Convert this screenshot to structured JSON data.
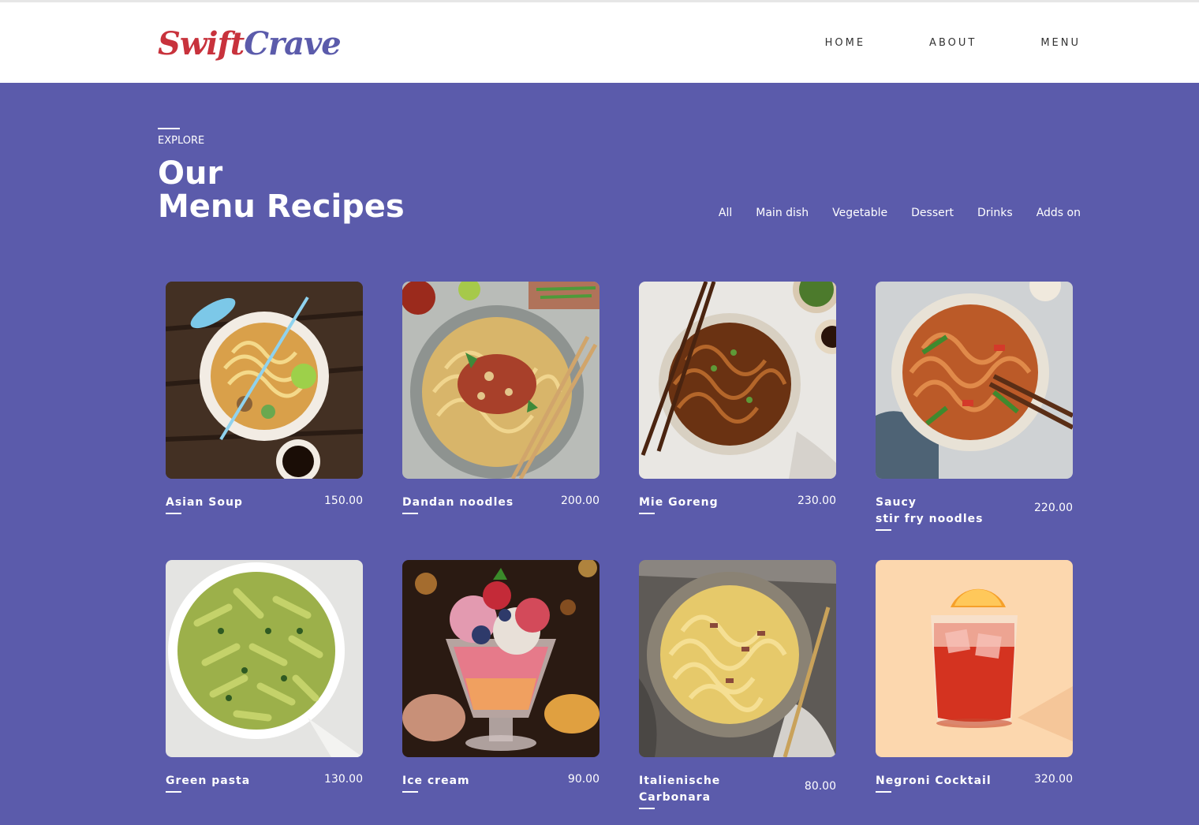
{
  "brand": {
    "part1": "Swift",
    "part2": "Crave"
  },
  "nav": [
    {
      "label": "HOME"
    },
    {
      "label": "ABOUT"
    },
    {
      "label": "MENU"
    }
  ],
  "section": {
    "eyebrow": "EXPLORE",
    "title_line1": "Our",
    "title_line2": "Menu Recipes"
  },
  "filters": [
    {
      "label": "All"
    },
    {
      "label": "Main dish"
    },
    {
      "label": "Vegetable"
    },
    {
      "label": "Dessert"
    },
    {
      "label": "Drinks"
    },
    {
      "label": "Adds on"
    }
  ],
  "menu_items": [
    {
      "name_line1": "Asian Soup",
      "name_line2": "",
      "price": "150.00",
      "image": "asian-soup-photo"
    },
    {
      "name_line1": "Dandan noodles",
      "name_line2": "",
      "price": "200.00",
      "image": "dandan-noodles-photo"
    },
    {
      "name_line1": "Mie Goreng",
      "name_line2": "",
      "price": "230.00",
      "image": "mie-goreng-photo"
    },
    {
      "name_line1": "Saucy",
      "name_line2": "stir fry noodles",
      "price": "220.00",
      "image": "stir-fry-noodles-photo"
    },
    {
      "name_line1": "Green pasta",
      "name_line2": "",
      "price": "130.00",
      "image": "green-pasta-photo"
    },
    {
      "name_line1": "Ice cream",
      "name_line2": "",
      "price": "90.00",
      "image": "ice-cream-photo"
    },
    {
      "name_line1": "Italienische",
      "name_line2": "Carbonara",
      "price": "80.00",
      "image": "carbonara-photo"
    },
    {
      "name_line1": "Negroni Cocktail",
      "name_line2": "",
      "price": "320.00",
      "image": "negroni-cocktail-photo"
    }
  ],
  "colors": {
    "brand_red": "#c8323c",
    "brand_purple": "#5b5bab",
    "background": "#5b5bab",
    "header_bg": "#ffffff"
  }
}
